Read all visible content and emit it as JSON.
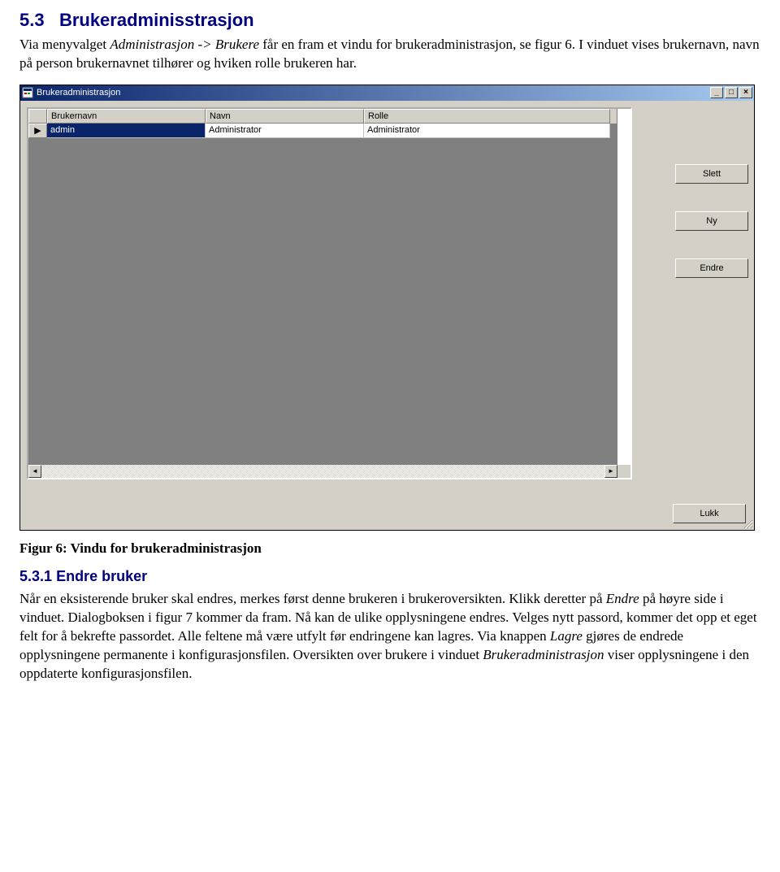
{
  "document": {
    "section_number": "5.3",
    "section_title": "Brukeradminisstrasjon",
    "intro_paragraph_1a": "Via menyvalget ",
    "intro_paragraph_1b": "Administrasjon -> Brukere",
    "intro_paragraph_1c": " får en fram et vindu for brukeradministrasjon, se figur 6. I vinduet vises brukernavn, navn på person brukernavnet tilhører og hviken rolle brukeren har.",
    "figure_caption": "Figur 6: Vindu for brukeradministrasjon",
    "subsection_number": "5.3.1",
    "subsection_title": "Endre bruker",
    "endre_p_a": "Når en eksisterende bruker skal endres, merkes først denne brukeren i brukeroversikten. Klikk deretter på ",
    "endre_p_b": "Endre",
    "endre_p_c": " på høyre side i vinduet. Dialogboksen i figur 7 kommer da fram. Nå kan de ulike opplysningene endres. Velges nytt passord, kommer det opp et eget felt for å bekrefte passordet. Alle feltene må være utfylt før endringene kan lagres. Via knappen ",
    "endre_p_d": "Lagre",
    "endre_p_e": " gjøres de endrede opplysningene permanente i konfigurasjonsfilen. Oversikten over brukere i vinduet ",
    "endre_p_f": "Brukeradministrasjon",
    "endre_p_g": " viser opplysningene i den oppdaterte konfigurasjonsfilen."
  },
  "window": {
    "title": "Brukeradministrasjon",
    "grid": {
      "headers": {
        "col1": "Brukernavn",
        "col2": "Navn",
        "col3": "Rolle"
      },
      "row_marker": "▶",
      "row": {
        "brukernavn": "admin",
        "navn": "Administrator",
        "rolle": "Administrator"
      }
    },
    "buttons": {
      "slett": "Slett",
      "ny": "Ny",
      "endre": "Endre",
      "lukk": "Lukk"
    },
    "scroll": {
      "left": "◄",
      "right": "►"
    }
  }
}
